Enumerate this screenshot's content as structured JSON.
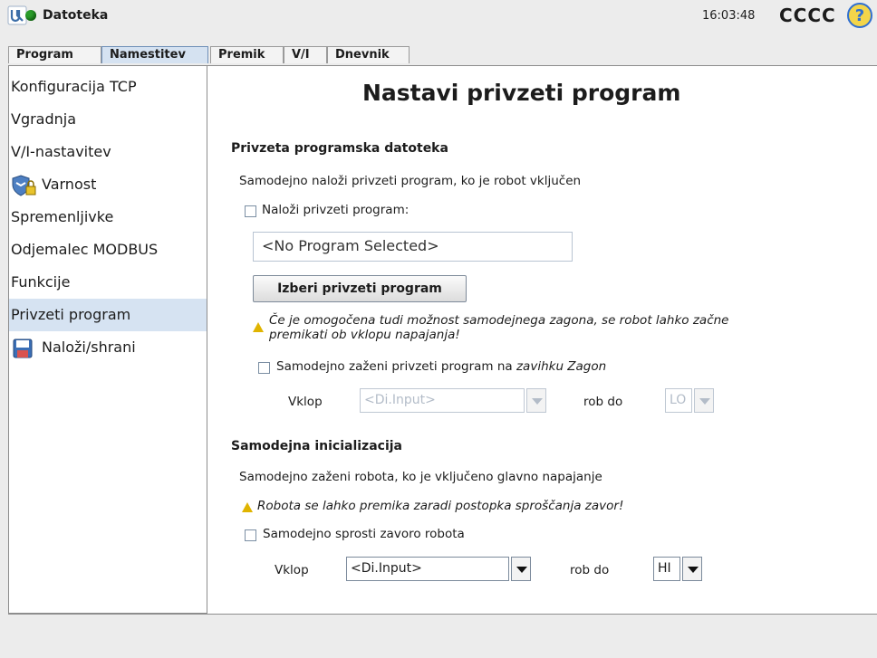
{
  "titlebar": {
    "title": "Datoteka",
    "time": "16:03:48",
    "robot_name": "CCCC"
  },
  "tabs": [
    {
      "label": "Program"
    },
    {
      "label": "Namestitev"
    },
    {
      "label": "Premik"
    },
    {
      "label": "V/I"
    },
    {
      "label": "Dnevnik"
    }
  ],
  "sidebar": {
    "items": [
      {
        "label": "Konfiguracija TCP"
      },
      {
        "label": "Vgradnja"
      },
      {
        "label": "V/I-nastavitev"
      },
      {
        "label": "Varnost"
      },
      {
        "label": "Spremenljivke"
      },
      {
        "label": "Odjemalec MODBUS"
      },
      {
        "label": "Funkcije"
      },
      {
        "label": "Privzeti program"
      },
      {
        "label": "Naloži/shrani"
      }
    ],
    "active": "Privzeti program"
  },
  "main": {
    "title": "Nastavi privzeti program",
    "section1": {
      "heading": "Privzeta programska datoteka",
      "desc": "Samodejno naloži privzeti program, ko je robot vključen",
      "load_checkbox_label": "Naloži privzeti program:",
      "program_field": "<No Program Selected>",
      "select_button": "Izberi privzeti program",
      "warning_line1": "Če je omogočena tudi možnost samodejnega zagona, se robot lahko začne",
      "warning_line2": "premikati ob vklopu napajanja!",
      "autostart_label_pre": "Samodejno zaženi privzeti program na ",
      "autostart_label_ital": "zavihku Zagon",
      "vklop_label": "Vklop",
      "input_value": "<Di.Input>",
      "edge_label": "rob do",
      "edge_value": "LO"
    },
    "section2": {
      "heading": "Samodejna inicializacija",
      "desc": "Samodejno zaženi robota, ko je vključeno glavno napajanje",
      "warning": "Robota se lahko premika zaradi postopka sproščanja zavor!",
      "brake_checkbox_label": "Samodejno sprosti zavoro robota",
      "vklop_label": "Vklop",
      "input_value": "<Di.Input>",
      "edge_label": "rob do",
      "edge_value": "HI"
    }
  },
  "colors": {
    "accent": "#d6e3f2",
    "warning": "#e0b400",
    "status_green": "#2a9d2a",
    "help_blue": "#2f6fd1"
  }
}
